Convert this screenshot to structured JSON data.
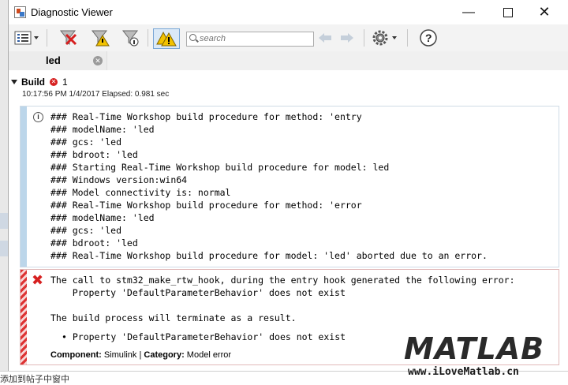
{
  "window": {
    "title": "Diagnostic Viewer"
  },
  "toolbar": {
    "search_placeholder": "search"
  },
  "tabs": [
    {
      "label": "led"
    }
  ],
  "build": {
    "label": "Build",
    "error_count": "1",
    "timestamp": "10:17:56 PM 1/4/2017   Elapsed: 0.981 sec"
  },
  "info_message": {
    "lines": [
      "### Real-Time Workshop build procedure for method: 'entry",
      "### modelName: 'led",
      "### gcs: 'led",
      "### bdroot: 'led",
      "### Starting Real-Time Workshop build procedure for model: led",
      "### Windows version:win64",
      "### Model connectivity is: normal",
      "### Real-Time Workshop build procedure for method: 'error",
      "### modelName: 'led",
      "### gcs: 'led",
      "### bdroot: 'led",
      "### Real-Time Workshop build procedure for model: 'led' aborted due to an error."
    ]
  },
  "error_message": {
    "line1": "The call to stm32_make_rtw_hook, during the entry hook generated the following error:",
    "line2": "    Property 'DefaultParameterBehavior' does not exist",
    "line3": "The build process will terminate as a result.",
    "bullet": "Property 'DefaultParameterBehavior' does not exist",
    "component_label": "Component:",
    "component_value": "Simulink",
    "separator": "|",
    "category_label": "Category:",
    "category_value": "Model error"
  },
  "watermark": {
    "logo": "MATLAB",
    "url": "www.iLoveMatlab.cn"
  },
  "background": {
    "bottom_text": "添加到帖子中窗中"
  },
  "colors": {
    "info_bar": "#bcd6ea",
    "error_red": "#d62020",
    "logo_blue": "#1e6fb5"
  }
}
